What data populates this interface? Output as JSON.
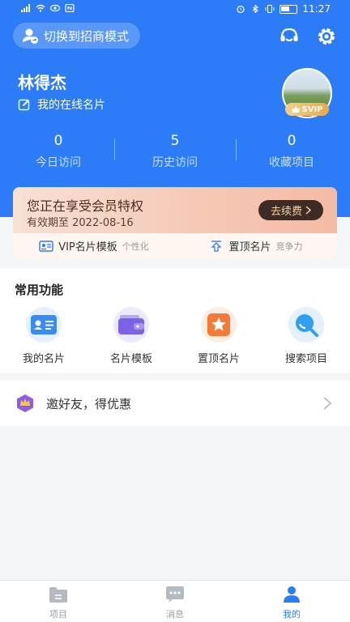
{
  "status_bar": {
    "time": "11:27"
  },
  "header": {
    "switch_mode_label": "切换到招商模式"
  },
  "profile": {
    "name": "林得杰",
    "online_card_label": "我的在线名片",
    "badge": "SVIP"
  },
  "stats": [
    {
      "value": "0",
      "label": "今日访问"
    },
    {
      "value": "5",
      "label": "历史访问"
    },
    {
      "value": "0",
      "label": "收藏项目"
    }
  ],
  "vip": {
    "title": "您正在享受会员特权",
    "expire": "有效期至 2022-08-16",
    "renew_label": "去续费",
    "features": [
      {
        "label": "VIP名片模板",
        "tag": "个性化"
      },
      {
        "label": "置顶名片",
        "tag": "竞争力"
      }
    ]
  },
  "functions": {
    "title": "常用功能",
    "items": [
      {
        "label": "我的名片",
        "icon": "id-card-icon"
      },
      {
        "label": "名片模板",
        "icon": "wallet-icon"
      },
      {
        "label": "置顶名片",
        "icon": "star-icon"
      },
      {
        "label": "搜索项目",
        "icon": "search-icon"
      }
    ]
  },
  "invite": {
    "label": "邀好友，得优惠"
  },
  "tabbar": [
    {
      "label": "项目",
      "active": false
    },
    {
      "label": "消息",
      "active": false
    },
    {
      "label": "我的",
      "active": true
    }
  ],
  "colors": {
    "primary": "#2b7cf6",
    "vip_dark": "#3d2c26",
    "vip_gold": "#e8a94b"
  }
}
